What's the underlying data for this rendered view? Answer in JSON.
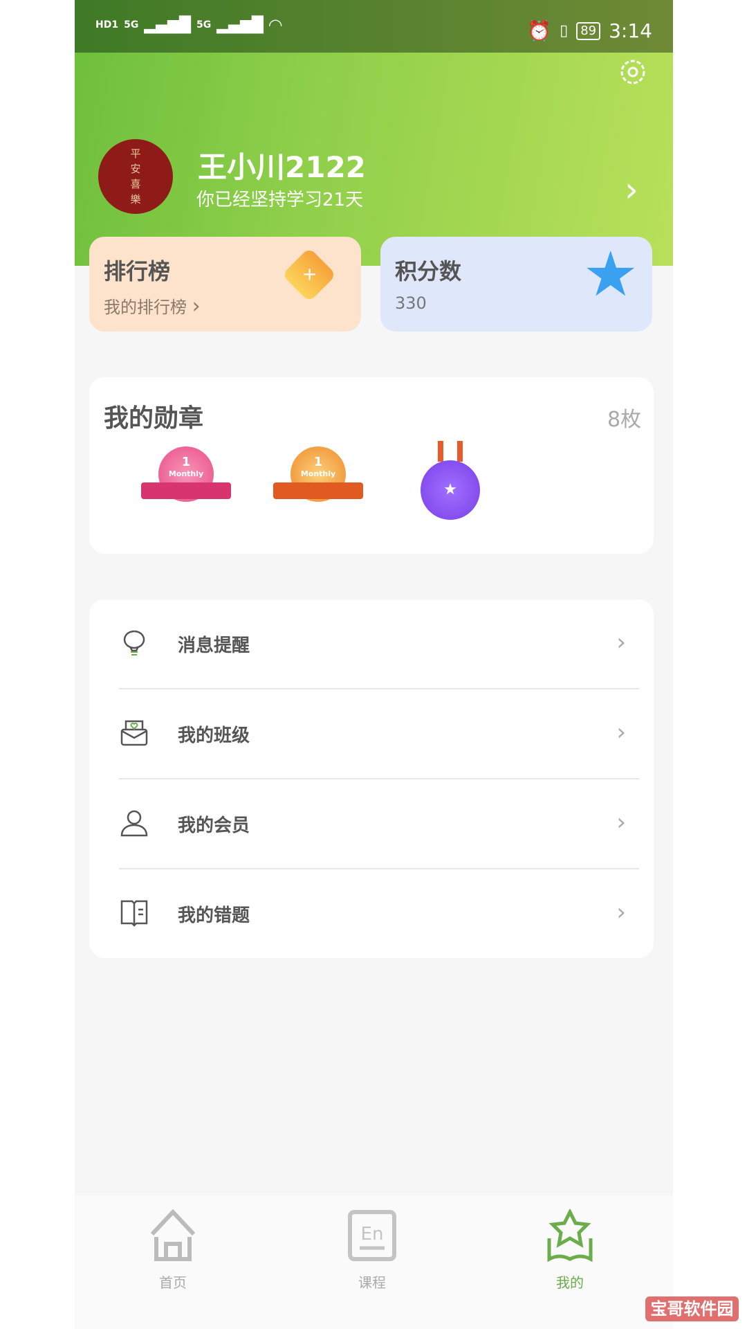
{
  "status_bar": {
    "left": [
      "HD1",
      "5G",
      "5G"
    ],
    "battery": "89",
    "time": "3:14"
  },
  "profile": {
    "avatar_text": [
      "平",
      "安",
      "喜",
      "樂"
    ],
    "name": "王小川2122",
    "subtitle": "你已经坚持学习21天"
  },
  "cards": {
    "rank": {
      "title": "排行榜",
      "link": "我的排行榜"
    },
    "points": {
      "title": "积分数",
      "value": "330"
    }
  },
  "badges": {
    "title": "我的勋章",
    "count": "8枚",
    "items": [
      {
        "label": "1",
        "sub": "Monthly",
        "color": "#e94d86"
      },
      {
        "label": "1",
        "sub": "Monthly",
        "color": "#f08a2a"
      },
      {
        "label": "",
        "sub": "",
        "color": "#8a4ff0"
      }
    ]
  },
  "menu": [
    {
      "label": "消息提醒",
      "icon": "lightbulb-icon"
    },
    {
      "label": "我的班级",
      "icon": "envelope-heart-icon"
    },
    {
      "label": "我的会员",
      "icon": "user-icon"
    },
    {
      "label": "我的错题",
      "icon": "book-icon"
    }
  ],
  "tabs": [
    {
      "label": "首页",
      "active": false
    },
    {
      "label": "课程",
      "active": false
    },
    {
      "label": "我的",
      "active": true
    }
  ],
  "colors": {
    "accent": "#6aad4a",
    "header": "#8fcf4a"
  },
  "watermark": "宝哥软件园"
}
